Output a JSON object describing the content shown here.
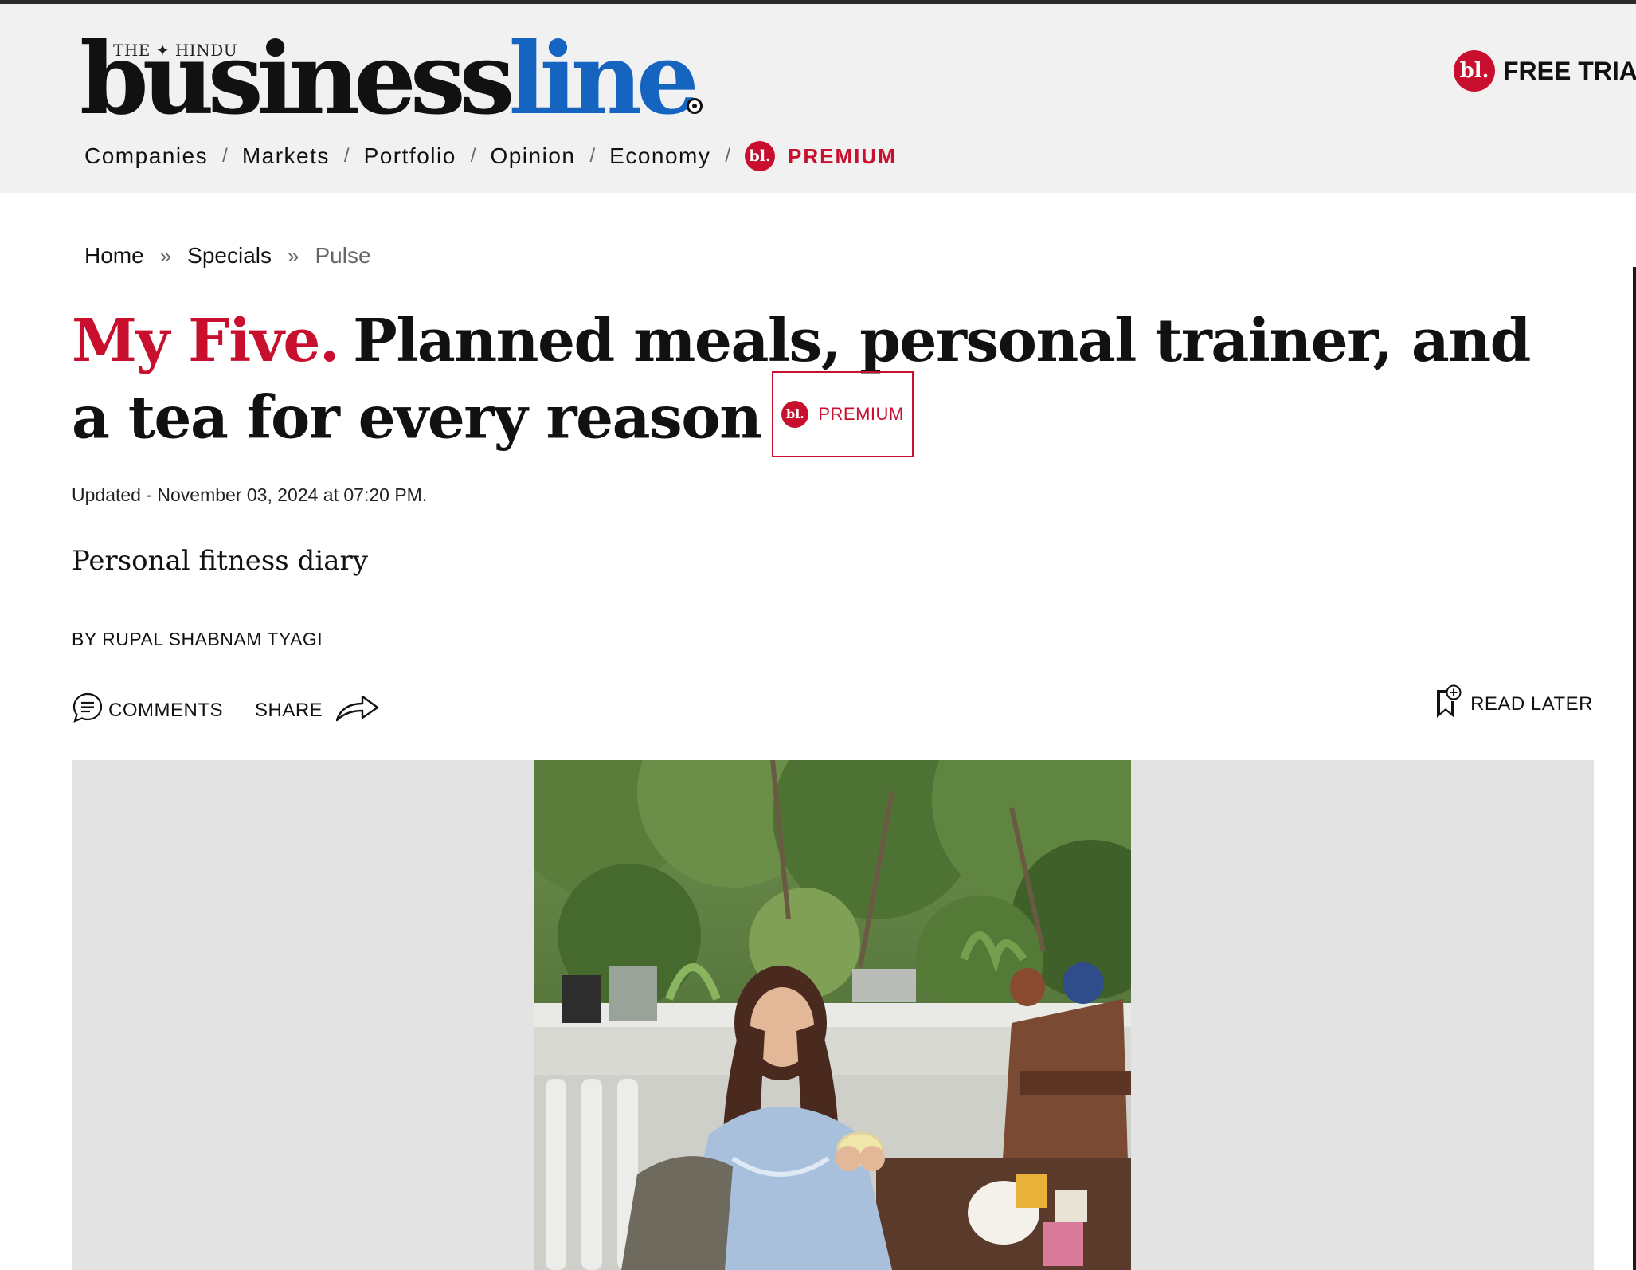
{
  "brand": {
    "masthead_small": "THE ✦ HINDU",
    "name_part1": "business",
    "name_part2": "line",
    "badge": "bl."
  },
  "header": {
    "free_trial": "FREE TRIAL"
  },
  "nav": {
    "items": [
      "Companies",
      "Markets",
      "Portfolio",
      "Opinion",
      "Economy"
    ],
    "separator": "/",
    "premium_label": "PREMIUM"
  },
  "breadcrumb": {
    "items": [
      "Home",
      "Specials",
      "Pulse"
    ],
    "separator": "»"
  },
  "article": {
    "kicker": "My Five.",
    "title": "Planned meals, personal trainer, and a tea for every reason",
    "premium_tag": "PREMIUM",
    "updated": "Updated - November 03, 2024 at 07:20 PM.",
    "subtitle": "Personal fitness diary",
    "byline": "BY RUPAL SHABNAM TYAGI"
  },
  "actions": {
    "comments": "COMMENTS",
    "share": "SHARE",
    "read_later": "READ LATER"
  },
  "colors": {
    "brand_red": "#c8102e",
    "brand_blue": "#1565c0",
    "header_bg": "#f1f1f1",
    "media_bg": "#e3e3e3"
  },
  "icons": [
    "bl-logo-icon",
    "comment-icon",
    "share-arrow-icon",
    "bookmark-plus-icon"
  ]
}
